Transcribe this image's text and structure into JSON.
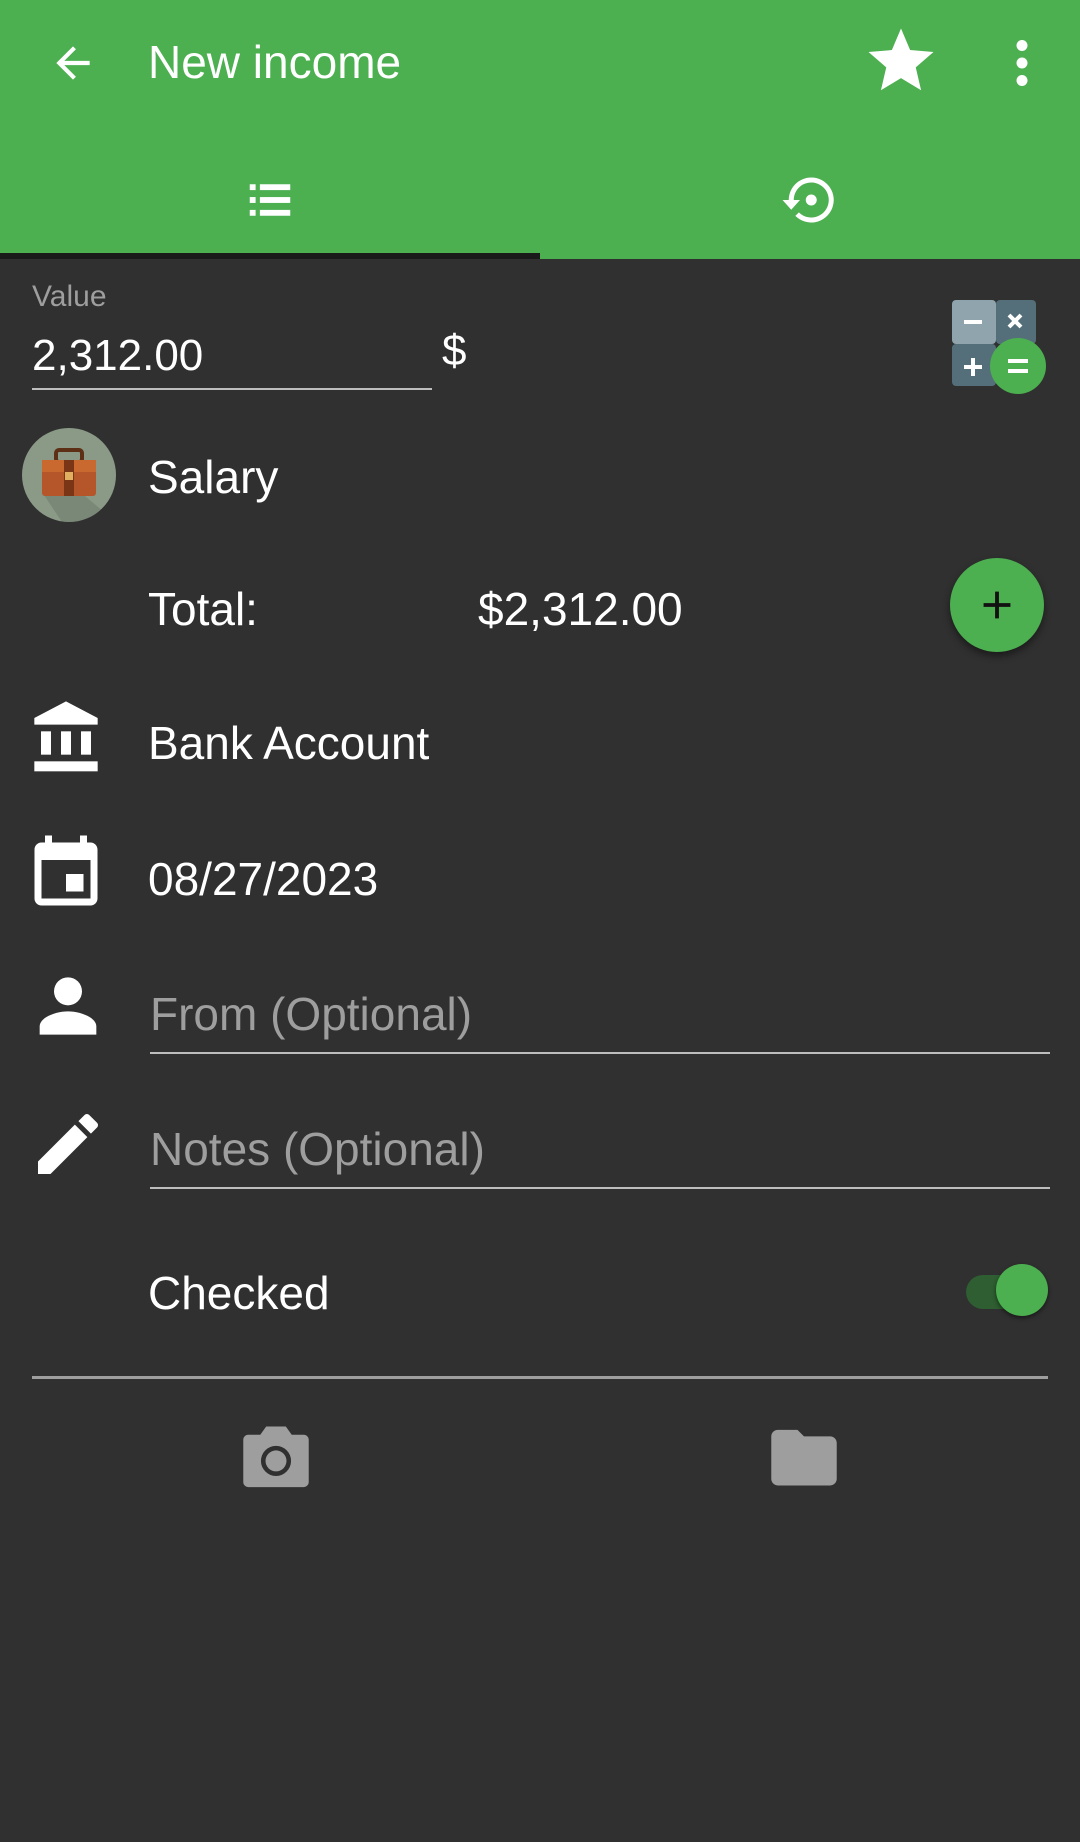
{
  "appbar": {
    "title": "New income",
    "color": "#4CAF50",
    "icons": [
      "back-arrow-icon",
      "star-icon",
      "more-vert-icon"
    ]
  },
  "tabs": [
    {
      "icon": "list-icon",
      "selected": true
    },
    {
      "icon": "history-icon",
      "selected": false
    }
  ],
  "form": {
    "value_label": "Value",
    "value": "2,312.00",
    "currency_symbol": "$",
    "category": "Salary",
    "total_label": "Total:",
    "total_value": "$2,312.00",
    "account": "Bank Account",
    "date": "08/27/2023",
    "from_placeholder": "From (Optional)",
    "notes_placeholder": "Notes (Optional)",
    "checked_label": "Checked",
    "checked": true
  },
  "attachments": {
    "icons": [
      "camera-icon",
      "folder-icon"
    ]
  }
}
